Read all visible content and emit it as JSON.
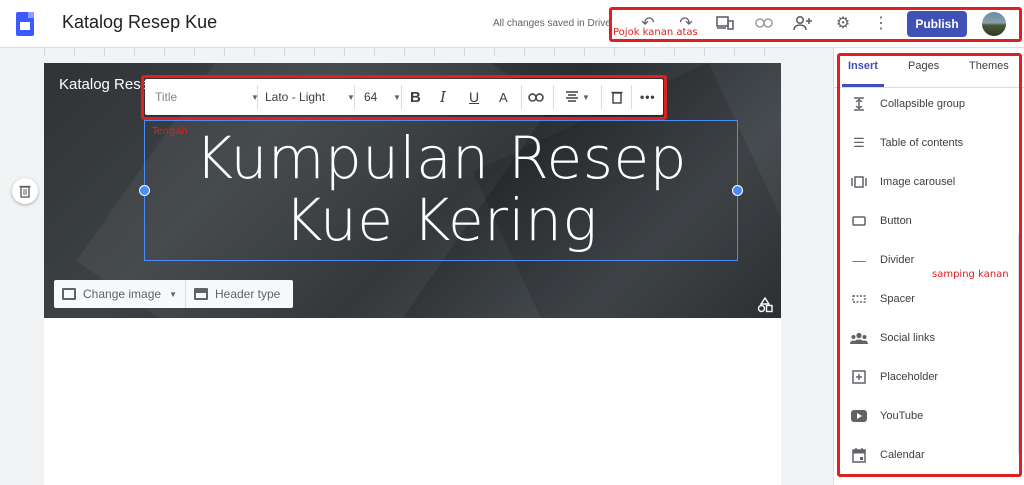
{
  "app": {
    "doc_title": "Katalog Resep Kue",
    "saved_status": "All changes saved in Drive",
    "publish_label": "Publish"
  },
  "site": {
    "site_name": "Katalog Resep",
    "main_title_line1": "Kumpulan Resep",
    "main_title_line2": "Kue Kering"
  },
  "format_toolbar": {
    "style_value": "Title",
    "font_value": "Lato - Light",
    "size_value": "64"
  },
  "header_controls": {
    "change_image_label": "Change image",
    "header_type_label": "Header type"
  },
  "side_panel": {
    "tabs": [
      {
        "label": "Insert"
      },
      {
        "label": "Pages"
      },
      {
        "label": "Themes"
      }
    ],
    "insert_items": [
      {
        "label": "Collapsible group",
        "icon": "collapsible-icon"
      },
      {
        "label": "Table of contents",
        "icon": "list-icon"
      },
      {
        "label": "Image carousel",
        "icon": "carousel-icon"
      },
      {
        "label": "Button",
        "icon": "button-icon"
      },
      {
        "label": "Divider",
        "icon": "divider-icon"
      },
      {
        "label": "Spacer",
        "icon": "spacer-icon"
      },
      {
        "label": "Social links",
        "icon": "people-icon"
      },
      {
        "label": "Placeholder",
        "icon": "plus-box-icon"
      },
      {
        "label": "YouTube",
        "icon": "youtube-icon"
      },
      {
        "label": "Calendar",
        "icon": "calendar-icon"
      }
    ]
  },
  "annotations": {
    "top_right_label": "Pojok kanan atas",
    "center_label": "Tengah",
    "side_right_label": "samping kanan"
  },
  "colors": {
    "accent": "#3f51b5",
    "annotation": "#e02020",
    "selection": "#4a8df6"
  }
}
